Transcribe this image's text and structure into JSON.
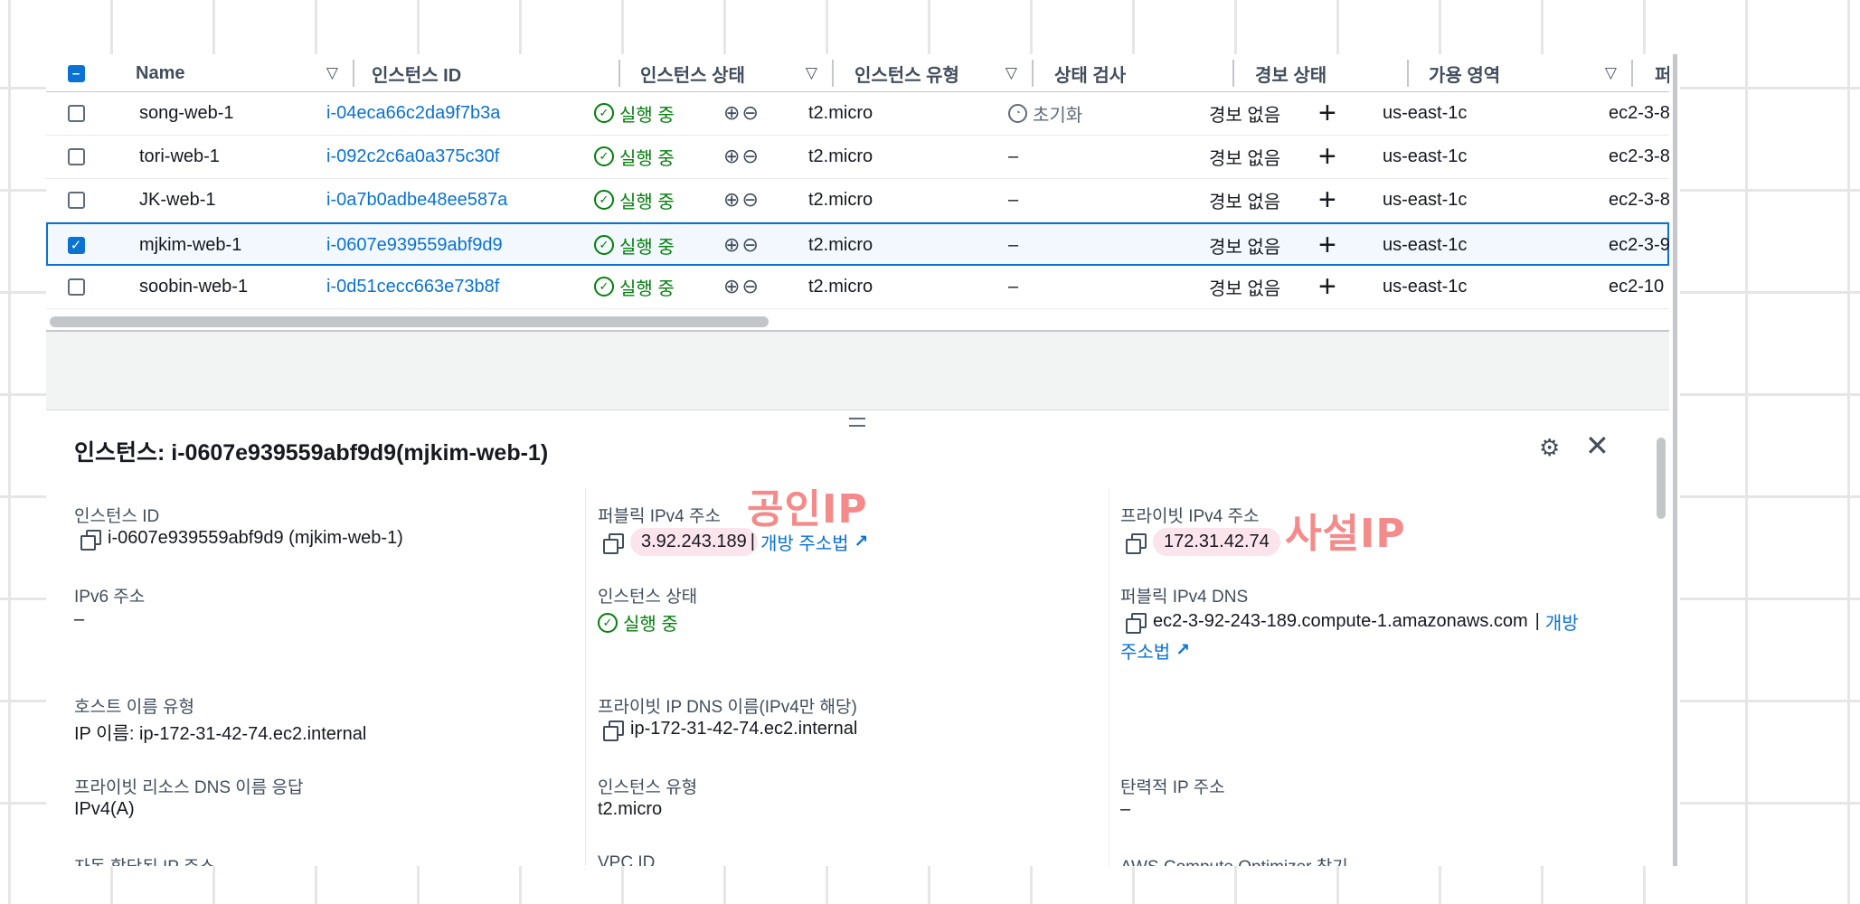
{
  "table": {
    "headers": {
      "name": "Name",
      "instance_id": "인스턴스 ID",
      "instance_state": "인스턴스 상태",
      "instance_type": "인스턴스 유형",
      "status_check": "상태 검사",
      "alarm_status": "경보 상태",
      "az": "가용 영역",
      "public_dns": "퍼블릭 I"
    },
    "rows": [
      {
        "name": "song-web-1",
        "id": "i-04eca66c2da9f7b3a",
        "state": "실행 중",
        "type": "t2.micro",
        "check": "초기화",
        "alarm": "경보 없음",
        "az": "us-east-1c",
        "dns": "ec2-3-8"
      },
      {
        "name": "tori-web-1",
        "id": "i-092c2c6a0a375c30f",
        "state": "실행 중",
        "type": "t2.micro",
        "check": "–",
        "alarm": "경보 없음",
        "az": "us-east-1c",
        "dns": "ec2-3-8"
      },
      {
        "name": "JK-web-1",
        "id": "i-0a7b0adbe48ee587a",
        "state": "실행 중",
        "type": "t2.micro",
        "check": "–",
        "alarm": "경보 없음",
        "az": "us-east-1c",
        "dns": "ec2-3-8"
      },
      {
        "name": "mjkim-web-1",
        "id": "i-0607e939559abf9d9",
        "state": "실행 중",
        "type": "t2.micro",
        "check": "–",
        "alarm": "경보 없음",
        "az": "us-east-1c",
        "dns": "ec2-3-9",
        "selected": true
      },
      {
        "name": "soobin-web-1",
        "id": "i-0d51cecc663e73b8f",
        "state": "실행 중",
        "type": "t2.micro",
        "check": "–",
        "alarm": "경보 없음",
        "az": "us-east-1c",
        "dns": "ec2-10"
      }
    ]
  },
  "detail": {
    "title": "인스턴스: i-0607e939559abf9d9(mjkim-web-1)",
    "col1": {
      "instance_id_label": "인스턴스 ID",
      "instance_id_value": "i-0607e939559abf9d9 (mjkim-web-1)",
      "ipv6_label": "IPv6 주소",
      "ipv6_value": "–",
      "hostname_type_label": "호스트 이름 유형",
      "hostname_type_value": "IP 이름: ip-172-31-42-74.ec2.internal",
      "private_dns_answer_label": "프라이빗 리소스 DNS 이름 응답",
      "private_dns_answer_value": "IPv4(A)",
      "auto_ip_label": "자동 할당된 IP 주소"
    },
    "col2": {
      "public_ipv4_label": "퍼블릭 IPv4 주소",
      "public_ipv4_value": "3.92.243.189",
      "separator": "|",
      "open_address_link": "개방 주소법",
      "state_label": "인스턴스 상태",
      "state_value": "실행 중",
      "private_dns_label": "프라이빗 IP DNS 이름(IPv4만 해당)",
      "private_dns_value": "ip-172-31-42-74.ec2.internal",
      "type_label": "인스턴스 유형",
      "type_value": "t2.micro",
      "vpc_label": "VPC ID"
    },
    "col3": {
      "private_ipv4_label": "프라이빗 IPv4 주소",
      "private_ipv4_value": "172.31.42.74",
      "public_dns_label": "퍼블릭 IPv4 DNS",
      "public_dns_value": "ec2-3-92-243-189.compute-1.amazonaws.com",
      "separator": "|",
      "open_link_part1": "개방",
      "open_link_part2": "주소법",
      "elastic_ip_label": "탄력적 IP 주소",
      "elastic_ip_value": "–",
      "optimizer_label": "AWS Compute Optimizer 찾기"
    }
  },
  "annotations": {
    "public_ip": "공인IP",
    "private_ip": "사설IP"
  },
  "colors": {
    "accent": "#0972d3",
    "success": "#037f0c",
    "annotation": "#f48a8a",
    "highlight": "#fce4ec"
  },
  "icons": [
    "filter-icon",
    "check-circle-icon",
    "zoom-in-icon",
    "zoom-out-icon",
    "clock-icon",
    "plus-icon",
    "copy-icon",
    "external-link-icon",
    "gear-icon",
    "close-icon"
  ]
}
